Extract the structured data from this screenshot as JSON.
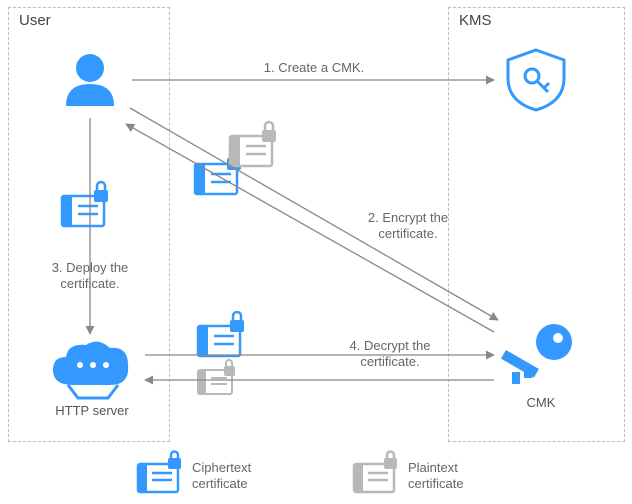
{
  "boxes": {
    "user": {
      "title": "User"
    },
    "kms": {
      "title": "KMS"
    }
  },
  "nodes": {
    "user": "",
    "shield": "",
    "server": "HTTP server",
    "cmk": "CMK"
  },
  "steps": {
    "s1": "1. Create a CMK.",
    "s2": "2. Encrypt the\ncertificate.",
    "s3": "3. Deploy the\ncertificate.",
    "s4": "4. Decrypt the\ncertificate."
  },
  "legend": {
    "cipher": "Ciphertext\ncertificate",
    "plain": "Plaintext\ncertificate"
  },
  "colors": {
    "accent": "#3399ff",
    "line": "#888888",
    "muted": "#b8b8b8"
  }
}
